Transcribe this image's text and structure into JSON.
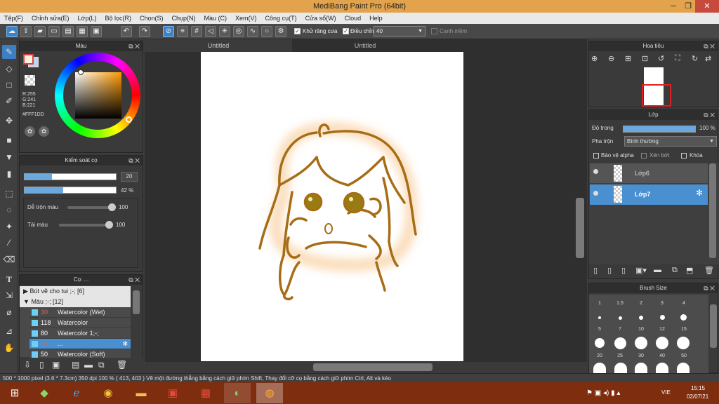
{
  "title": "MediBang Paint Pro (64bit)",
  "window_controls": [
    "─",
    "❐",
    "✕"
  ],
  "menu": [
    "Tệp(F)",
    "Chỉnh sửa(E)",
    "Lớp(L)",
    "Bộ lọc(R)",
    "Chọn(S)",
    "Chụp(N)",
    "Màu (C)",
    "Xem(V)",
    "Công cụ(T)",
    "Cửa sổ(W)",
    "Cloud",
    "Help"
  ],
  "toolbar": {
    "antialias_label": "Khử răng cưa",
    "correction_label": "Điều chỉnh",
    "correction_value": "40",
    "soft_edge_label": "Cạnh mềm"
  },
  "color_panel": {
    "title": "Màu",
    "r": "R:255",
    "g": "G:241",
    "b": "B:221",
    "hex": "#FFF1DD",
    "main_color": "#fff1dd",
    "sub_color": "#bcd6ee"
  },
  "brush_control": {
    "title": "Kiểm soát cọ",
    "size_value": "20",
    "opacity_value": "42 %",
    "size_fill": 0.3,
    "opacity_fill": 0.42,
    "blend_label": "Dễ trộn màu",
    "blend_value": "100",
    "blend_level": 1.0,
    "ink_label": "Tải màu",
    "ink_value": "100",
    "ink_level": 1.0
  },
  "brush_list": {
    "title": "Cọ: ...",
    "groups": [
      {
        "label": "Bút vẽ cho tui ;-; [6]",
        "arrow": "▶"
      },
      {
        "label": "Màu ;-; [12]",
        "arrow": "▼"
      }
    ],
    "items": [
      {
        "size": "30",
        "name": "Watercolor (Wet)",
        "size_color": "#e06060"
      },
      {
        "size": "118",
        "name": "Watercolor",
        "size_color": "#ffffff"
      },
      {
        "size": "80",
        "name": "Watercolor 1;-;",
        "size_color": "#ffffff"
      },
      {
        "size": "20",
        "name": "...",
        "size_color": "#e06060",
        "selected": true
      },
      {
        "size": "50",
        "name": "Watercolor (Soft)",
        "size_color": "#ffffff"
      }
    ]
  },
  "canvas": {
    "tabs": [
      "Untitled",
      "Untitled"
    ]
  },
  "navigator": {
    "title": "Hoa tiêu"
  },
  "layer_panel": {
    "title": "Lớp",
    "opacity_label": "Độ trong",
    "opacity_value": "100 %",
    "opacity_level": 1.0,
    "blend_label": "Pha trộn",
    "blend_value": "Bình thường",
    "protect_alpha": "Bảo vệ alpha",
    "clipping": "Xén bớt",
    "lock": "Khóa",
    "layers": [
      {
        "name": "Lớp6",
        "selected": false
      },
      {
        "name": "Lớp7",
        "selected": true
      }
    ]
  },
  "brush_size_panel": {
    "title": "Brush Size",
    "row1": [
      "1",
      "1.5",
      "2",
      "3",
      "4"
    ],
    "row2": [
      "5",
      "7",
      "10",
      "12",
      "15"
    ],
    "row3": [
      "20",
      "25",
      "30",
      "40",
      "50"
    ]
  },
  "status": {
    "text": "500 * 1000 pixel   (3.6 * 7.3cm)   350 dpi   100 %   ( 413, 403 )   Vẽ một đường thẳng bằng cách giữ phím Shift, Thay đổi cỡ cọ bằng cách giữ phím Ctrl, Alt và kéo"
  },
  "taskbar": {
    "lang": "VIE",
    "time": "15:15",
    "date": "02/07/21"
  }
}
